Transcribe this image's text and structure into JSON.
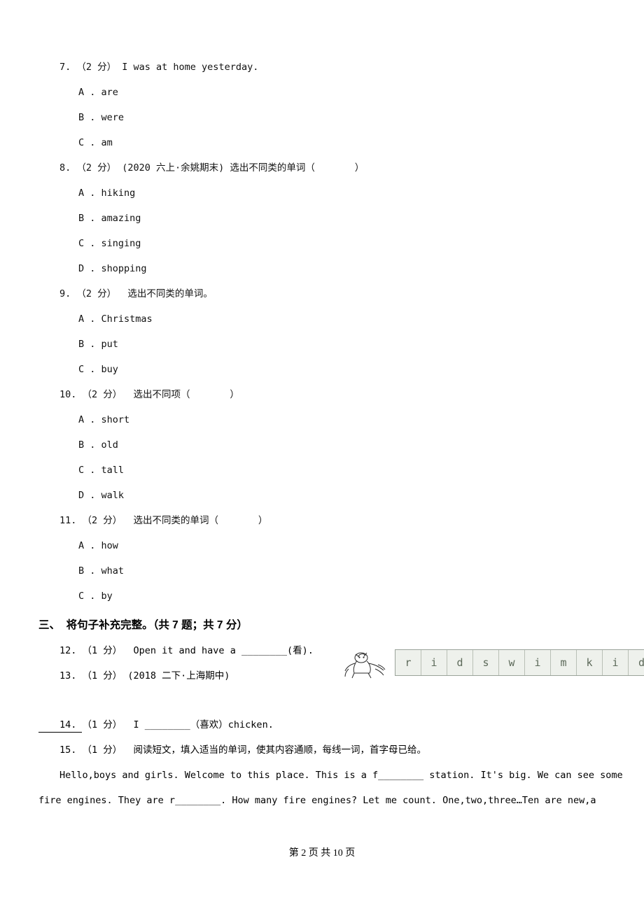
{
  "page": {
    "footer": "第 2 页 共 10 页"
  },
  "questions": [
    {
      "stem": "7. （2 分） I was at home yesterday.",
      "options": [
        "A . are",
        "B . were",
        "C . am"
      ]
    },
    {
      "stem": "8. （2 分） (2020 六上·余姚期末) 选出不同类的单词（       ）",
      "options": [
        "A . hiking",
        "B . amazing",
        "C . singing",
        "D . shopping"
      ]
    },
    {
      "stem": "9. （2 分）  选出不同类的单词。",
      "options": [
        "A . Christmas",
        "B . put",
        "C . buy"
      ]
    },
    {
      "stem": "10. （2 分）  选出不同项（       ）",
      "options": [
        "A . short",
        "B . old",
        "C . tall",
        "D . walk"
      ]
    },
    {
      "stem": "11. （2 分）  选出不同类的单词（       ）",
      "options": [
        "A . how",
        "B . what",
        "C . by"
      ]
    }
  ],
  "section": {
    "heading": "三、  将句子补充完整。（共 7 题；共 7 分）"
  },
  "fill_questions": [
    {
      "text": "12. （1 分）  Open it and have a ________(看)."
    },
    {
      "text_before": "13. （1 分） (2018 二下·上海期中)",
      "letters": [
        "r",
        "i",
        "d",
        "s",
        "w",
        "i",
        "m",
        "k",
        "i",
        "d"
      ]
    },
    {
      "text": "14. （1 分）  I ________（喜欢）chicken."
    },
    {
      "text": "15. （1 分）  阅读短文，填入适当的单词，使其内容通顺，每线一词，首字母已给。"
    }
  ],
  "passage": [
    "Hello,boys and girls. Welcome to this place. This is a f________ station. It's big. We can see some",
    "fire engines. They are r________. How many fire engines? Let me count. One,two,three…Ten are new,a"
  ]
}
